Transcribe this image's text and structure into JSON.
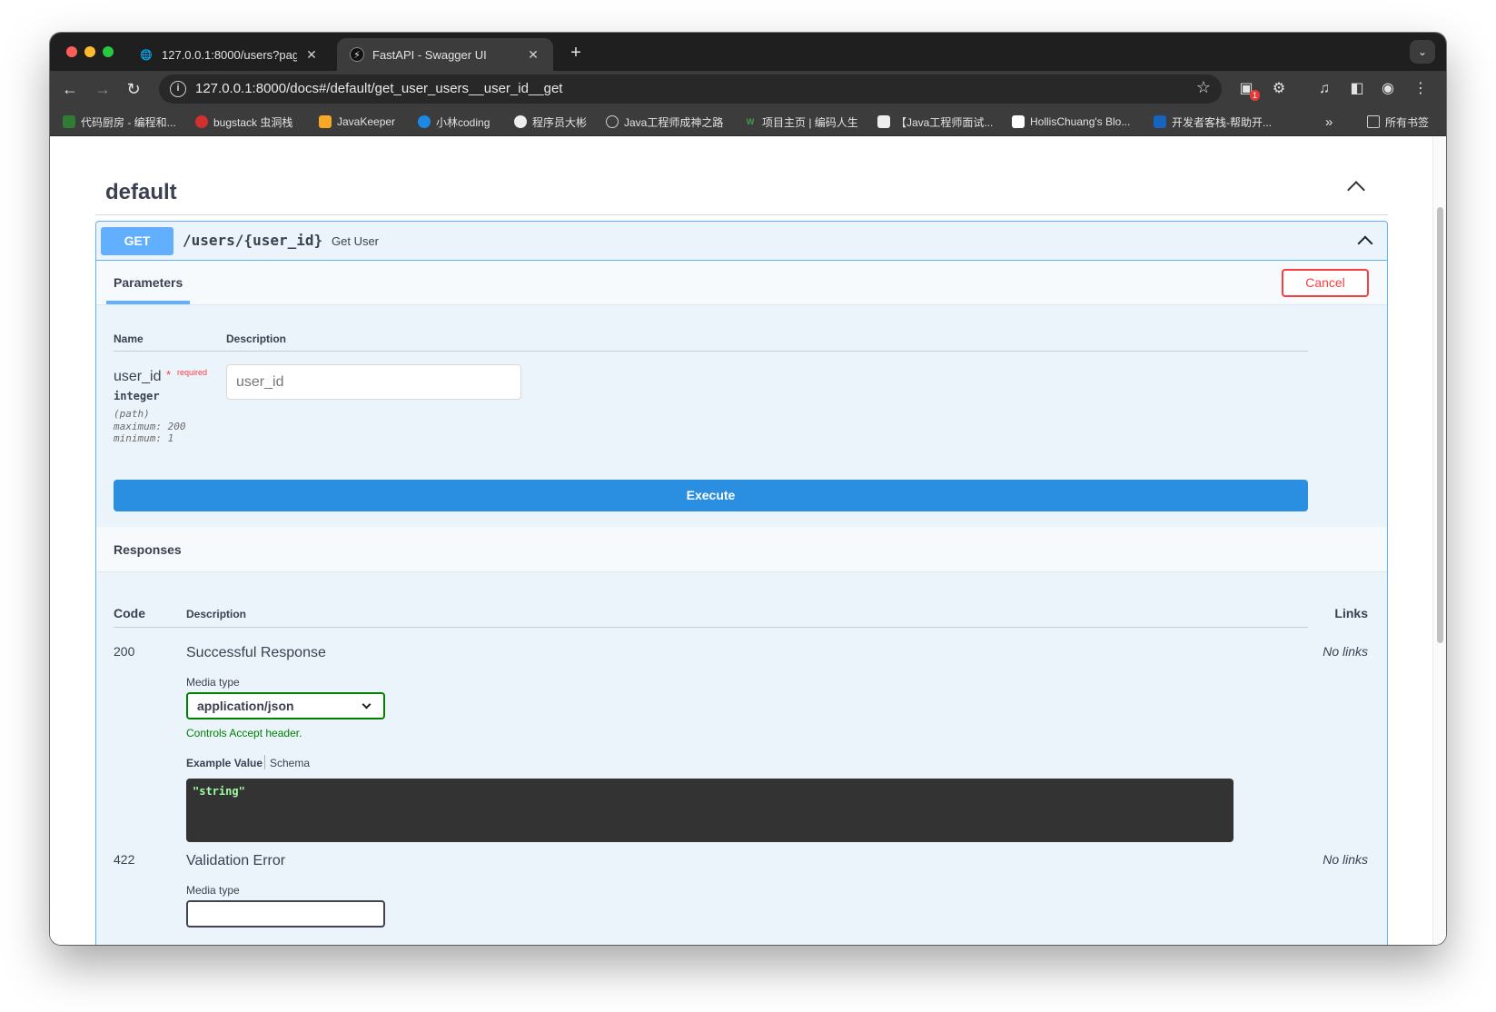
{
  "browser": {
    "tabs": [
      {
        "title": "127.0.0.1:8000/users?page_s",
        "active": false
      },
      {
        "title": "FastAPI - Swagger UI",
        "active": true
      }
    ],
    "new_tab": "+",
    "url": "127.0.0.1:8000/docs#/default/get_user_users__user_id__get",
    "extension_badge": "1",
    "bookmarks": [
      "代码厨房 - 编程和...",
      "bugstack 虫洞栈",
      "JavaKeeper",
      "小林coding",
      "程序员大彬",
      "Java工程师成神之路",
      "项目主页 | 编码人生",
      "【Java工程师面试...",
      "HollisChuang's Blo...",
      "开发者客栈-帮助开..."
    ],
    "bookmarks_more": "»",
    "all_bookmarks": "所有书签",
    "accent_color": "#3c3c3c"
  },
  "swagger": {
    "section_title": "default",
    "operation": {
      "method": "GET",
      "path": "/users/{user_id}",
      "summary": "Get User",
      "method_color": "#61affe"
    },
    "parameters_tab": "Parameters",
    "cancel_label": "Cancel",
    "param_table": {
      "name_header": "Name",
      "description_header": "Description",
      "param": {
        "name": "user_id",
        "required_star": "*",
        "required_label": "required",
        "type": "integer",
        "location": "(path)",
        "maximum": "maximum: 200",
        "minimum": "minimum: 1",
        "placeholder": "user_id"
      }
    },
    "execute_label": "Execute",
    "responses_title": "Responses",
    "responses_table": {
      "code_header": "Code",
      "description_header": "Description",
      "links_header": "Links",
      "rows": [
        {
          "code": "200",
          "description": "Successful Response",
          "links": "No links",
          "media_type_label": "Media type",
          "media_type": "application/json",
          "controls_note": "Controls Accept header.",
          "example_tab": "Example Value",
          "schema_tab": "Schema",
          "example": "\"string\""
        },
        {
          "code": "422",
          "description": "Validation Error",
          "links": "No links",
          "media_type_label": "Media type"
        }
      ]
    }
  }
}
